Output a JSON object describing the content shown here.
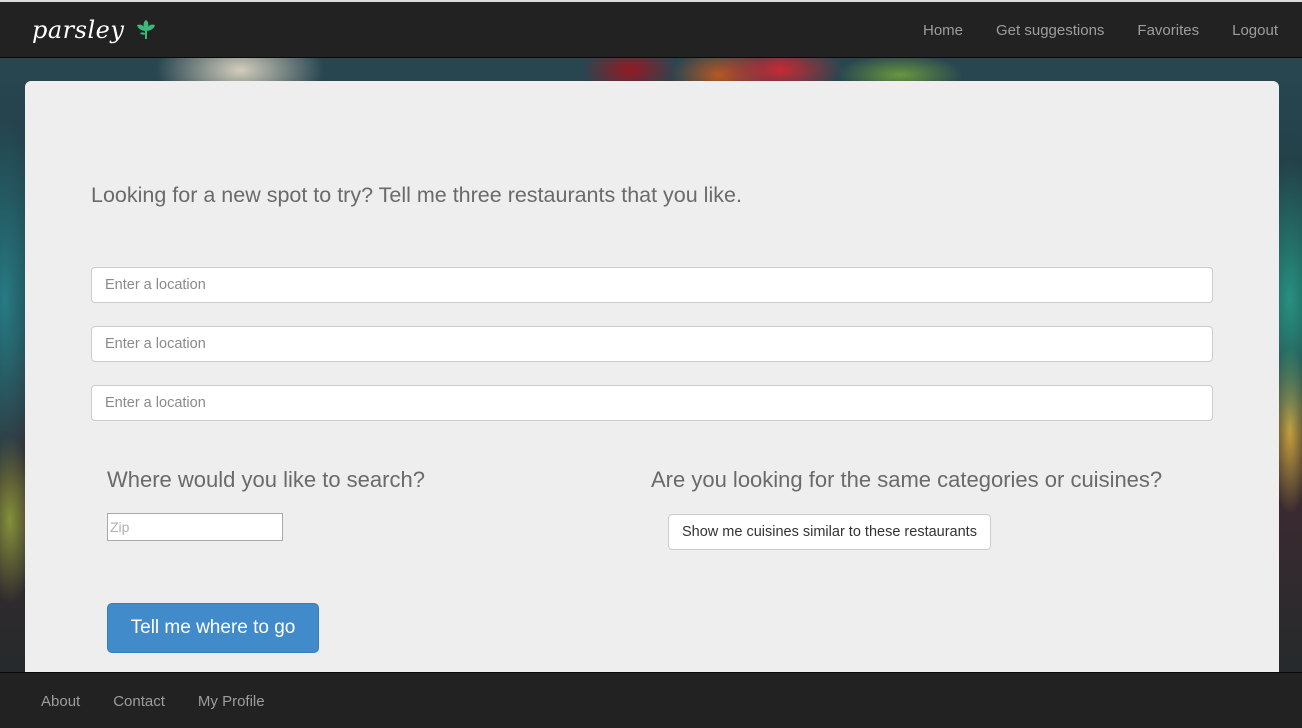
{
  "brand": {
    "name": "parsley",
    "icon": "parsley-leaf-icon",
    "icon_color": "#3cb878"
  },
  "nav": {
    "items": [
      {
        "label": "Home"
      },
      {
        "label": "Get suggestions"
      },
      {
        "label": "Favorites"
      },
      {
        "label": "Logout"
      }
    ]
  },
  "main": {
    "prompt": "Looking for a new spot to try? Tell me three restaurants that you like.",
    "restaurant_inputs": [
      {
        "placeholder": "Enter a location",
        "value": ""
      },
      {
        "placeholder": "Enter a location",
        "value": ""
      },
      {
        "placeholder": "Enter a location",
        "value": ""
      }
    ],
    "search_heading": "Where would you like to search?",
    "zip_placeholder": "Zip",
    "cuisine_heading": "Are you looking for the same categories or cuisines?",
    "similar_button": "Show me cuisines similar to these restaurants",
    "submit_button": "Tell me where to go"
  },
  "footer": {
    "items": [
      {
        "label": "About"
      },
      {
        "label": "Contact"
      },
      {
        "label": "My Profile"
      }
    ]
  },
  "colors": {
    "navbar": "#222222",
    "panel": "#eeeeee",
    "primary_button": "#428bca",
    "nav_text": "#9d9d9d"
  }
}
